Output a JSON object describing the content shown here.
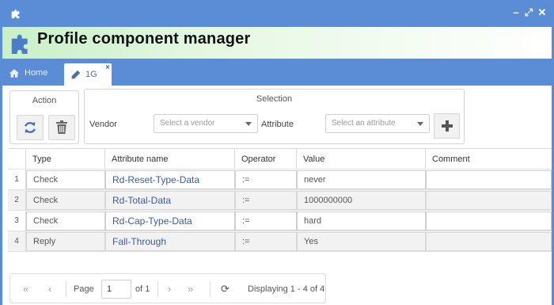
{
  "window": {
    "controls": {
      "minimize": "–",
      "restore": "⤢",
      "close": "✕"
    }
  },
  "header": {
    "title": "Profile component manager"
  },
  "tabs": {
    "home": "Home",
    "active": "1G",
    "close": "×"
  },
  "action": {
    "legend": "Action",
    "refresh_icon": "refresh-icon",
    "delete_icon": "trash-icon"
  },
  "selection": {
    "legend": "Selection",
    "vendor_label": "Vendor",
    "vendor_placeholder": "Select a vendor",
    "attribute_label": "Attribute",
    "attribute_placeholder": "Select an attribute",
    "add_icon": "plus-icon"
  },
  "grid": {
    "columns": [
      "Type",
      "Attribute name",
      "Operator",
      "Value",
      "Comment"
    ],
    "rows": [
      {
        "num": "1",
        "type": "Check",
        "attribute": "Rd-Reset-Type-Data",
        "operator": ":=",
        "value": "never",
        "comment": ""
      },
      {
        "num": "2",
        "type": "Check",
        "attribute": "Rd-Total-Data",
        "operator": ":=",
        "value": "1000000000",
        "comment": ""
      },
      {
        "num": "3",
        "type": "Check",
        "attribute": "Rd-Cap-Type-Data",
        "operator": ":=",
        "value": "hard",
        "comment": ""
      },
      {
        "num": "4",
        "type": "Reply",
        "attribute": "Fall-Through",
        "operator": ":=",
        "value": "Yes",
        "comment": ""
      }
    ]
  },
  "pager": {
    "first": "«",
    "prev": "‹",
    "page_label": "Page",
    "page_value": "1",
    "of_label": "of 1",
    "next": "›",
    "last": "»",
    "refresh": "⟳",
    "display": "Displaying 1 - 4 of 4"
  },
  "colors": {
    "accent": "#5b8dd6",
    "link": "#3a5ba0",
    "header_gradient": "#c8f0c8"
  }
}
